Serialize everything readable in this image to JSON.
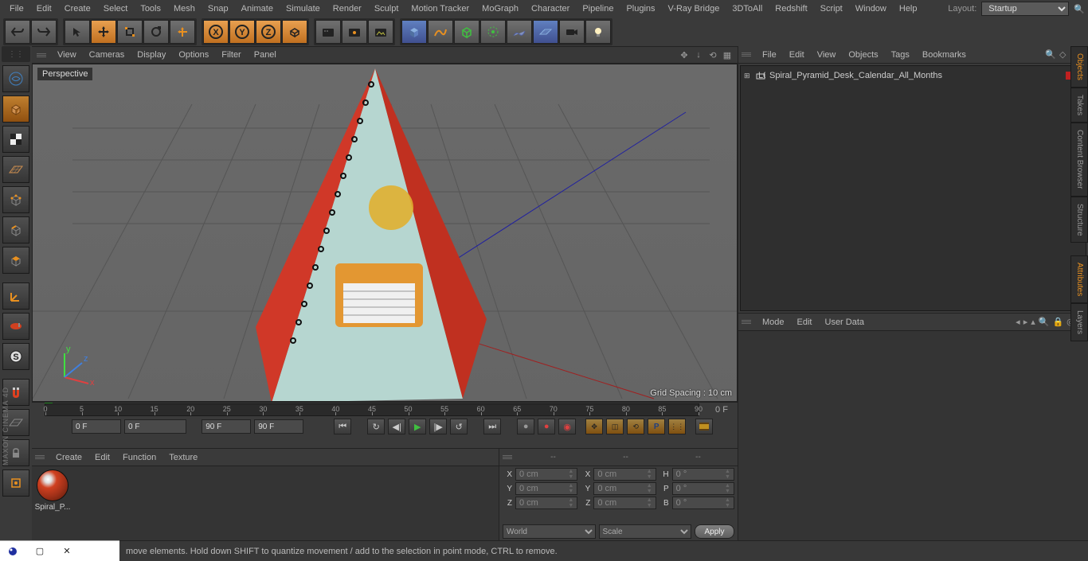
{
  "menubar": {
    "items": [
      "File",
      "Edit",
      "Create",
      "Select",
      "Tools",
      "Mesh",
      "Snap",
      "Animate",
      "Simulate",
      "Render",
      "Sculpt",
      "Motion Tracker",
      "MoGraph",
      "Character",
      "Pipeline",
      "Plugins",
      "V-Ray Bridge",
      "3DToAll",
      "Redshift",
      "Script",
      "Window",
      "Help"
    ],
    "layout_label": "Layout:",
    "layout_value": "Startup"
  },
  "viewport": {
    "menus": [
      "View",
      "Cameras",
      "Display",
      "Options",
      "Filter",
      "Panel"
    ],
    "label": "Perspective",
    "grid_spacing": "Grid Spacing : 10 cm"
  },
  "objects_panel": {
    "menus": [
      "File",
      "Edit",
      "View",
      "Objects",
      "Tags",
      "Bookmarks"
    ],
    "tree": {
      "root_label": "Spiral_Pyramid_Desk_Calendar_All_Months"
    }
  },
  "attributes_panel": {
    "menus": [
      "Mode",
      "Edit",
      "User Data"
    ]
  },
  "material_panel": {
    "menus": [
      "Create",
      "Edit",
      "Function",
      "Texture"
    ],
    "material_name": "Spiral_P..."
  },
  "coords": {
    "header1": "--",
    "header2": "--",
    "header3": "--",
    "rows": [
      {
        "l1": "X",
        "v1": "0 cm",
        "l2": "X",
        "v2": "0 cm",
        "l3": "H",
        "v3": "0 °"
      },
      {
        "l1": "Y",
        "v1": "0 cm",
        "l2": "Y",
        "v2": "0 cm",
        "l3": "P",
        "v3": "0 °"
      },
      {
        "l1": "Z",
        "v1": "0 cm",
        "l2": "Z",
        "v2": "0 cm",
        "l3": "B",
        "v3": "0 °"
      }
    ],
    "world_label": "World",
    "scale_label": "Scale",
    "apply_label": "Apply"
  },
  "timeline": {
    "ticks": [
      "0",
      "5",
      "10",
      "15",
      "20",
      "25",
      "30",
      "35",
      "40",
      "45",
      "50",
      "55",
      "60",
      "65",
      "70",
      "75",
      "80",
      "85",
      "90"
    ],
    "end_right": "0 F",
    "start_frame": "0 F",
    "start_frame2": "0 F",
    "end_frame": "90 F",
    "end_frame2": "90 F"
  },
  "side_tabs": [
    "Objects",
    "Takes",
    "Content Browser",
    "Structure",
    "Attributes",
    "Layers"
  ],
  "statusbar": {
    "hint": "move elements. Hold down SHIFT to quantize movement / add to the selection in point mode, CTRL to remove."
  }
}
